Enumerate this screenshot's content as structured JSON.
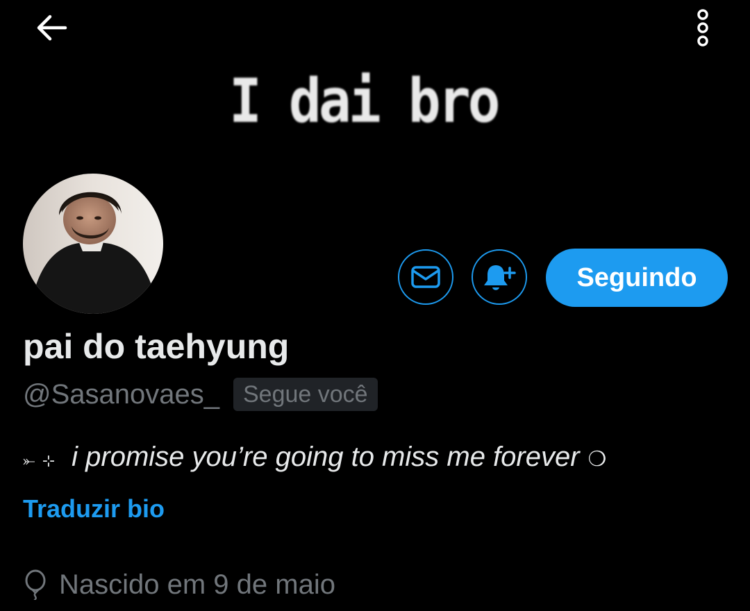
{
  "header": {
    "back_icon": "arrow-left-icon",
    "more_icon": "more-vertical-icon"
  },
  "banner": {
    "text": "I dai bro"
  },
  "profile": {
    "display_name": "pai do taehyung",
    "handle": "@Sasanovaes_",
    "follows_you_badge": "Segue você",
    "bio_prefix": "⤜ ⊹",
    "bio_text": "i promise you’re going to miss me forever",
    "bio_suffix": "❍",
    "translate_label": "Traduzir bio",
    "birth_text": "Nascido em 9 de maio",
    "birth_icon": "balloon-icon"
  },
  "actions": {
    "message_icon": "envelope-icon",
    "notify_icon": "bell-plus-icon",
    "follow_label": "Seguindo"
  },
  "colors": {
    "background": "#000000",
    "accent": "#1d9bf0",
    "primary_text": "#e7e9ea",
    "secondary_text": "#71767b",
    "badge_bg": "#202327"
  }
}
